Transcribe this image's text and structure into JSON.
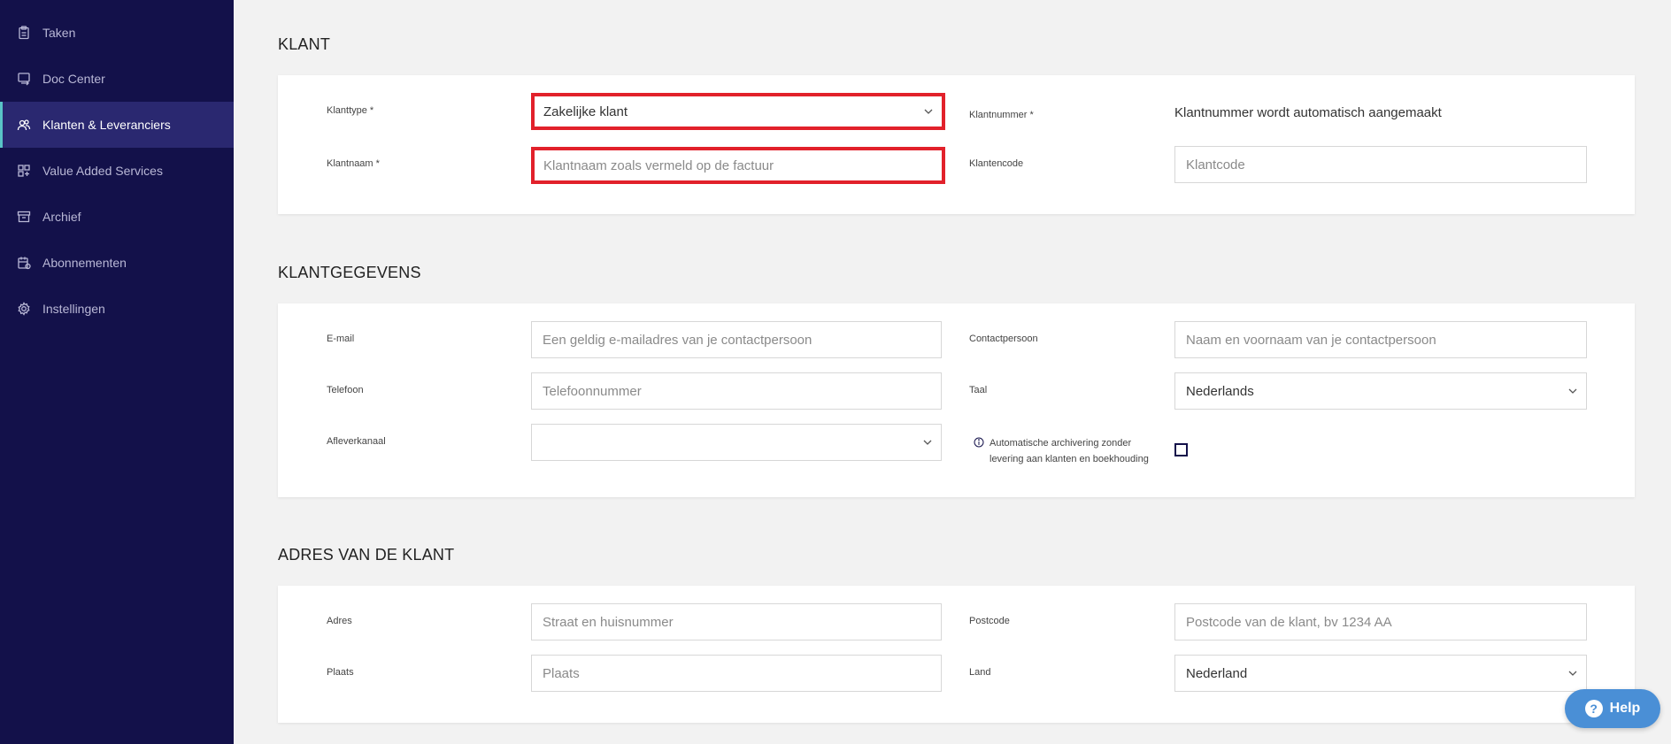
{
  "sidebar": {
    "items": [
      {
        "label": "Taken",
        "icon": "clipboard-icon"
      },
      {
        "label": "Doc Center",
        "icon": "doc-transfer-icon"
      },
      {
        "label": "Klanten & Leveranciers",
        "icon": "users-icon",
        "active": true
      },
      {
        "label": "Value Added Services",
        "icon": "grid-plus-icon"
      },
      {
        "label": "Archief",
        "icon": "archive-icon"
      },
      {
        "label": "Abonnementen",
        "icon": "calendar-icon"
      },
      {
        "label": "Instellingen",
        "icon": "gear-icon"
      }
    ]
  },
  "klant": {
    "title": "KLANT",
    "klanttype_label": "Klanttype *",
    "klanttype_value": "Zakelijke klant",
    "klantnaam_label": "Klantnaam *",
    "klantnaam_placeholder": "Klantnaam zoals vermeld op de factuur",
    "klantnummer_label": "Klantnummer *",
    "klantnummer_text": "Klantnummer wordt automatisch aangemaakt",
    "klantencode_label": "Klantencode",
    "klantencode_placeholder": "Klantcode"
  },
  "klantgegevens": {
    "title": "KLANTGEGEVENS",
    "email_label": "E-mail",
    "email_placeholder": "Een geldig e-mailadres van je contactpersoon",
    "contactpersoon_label": "Contactpersoon",
    "contactpersoon_placeholder": "Naam en voornaam van je contactpersoon",
    "telefoon_label": "Telefoon",
    "telefoon_placeholder": "Telefoonnummer",
    "taal_label": "Taal",
    "taal_value": "Nederlands",
    "afleverkanaal_label": "Afleverkanaal",
    "afleverkanaal_value": "",
    "archivering_text": "Automatische archivering zonder levering aan klanten en boekhouding",
    "archivering_checked": false
  },
  "adres": {
    "title": "ADRES VAN DE KLANT",
    "adres_label": "Adres",
    "adres_placeholder": "Straat en huisnummer",
    "postcode_label": "Postcode",
    "postcode_placeholder": "Postcode van de klant, bv 1234 AA",
    "plaats_label": "Plaats",
    "plaats_placeholder": "Plaats",
    "land_label": "Land",
    "land_value": "Nederland"
  },
  "help": {
    "label": "Help"
  },
  "colors": {
    "sidebar_bg": "#13114a",
    "sidebar_active": "#2a2870",
    "accent": "#59c4c7",
    "highlight": "#e2212b",
    "help_bg": "#4a8fd6"
  }
}
